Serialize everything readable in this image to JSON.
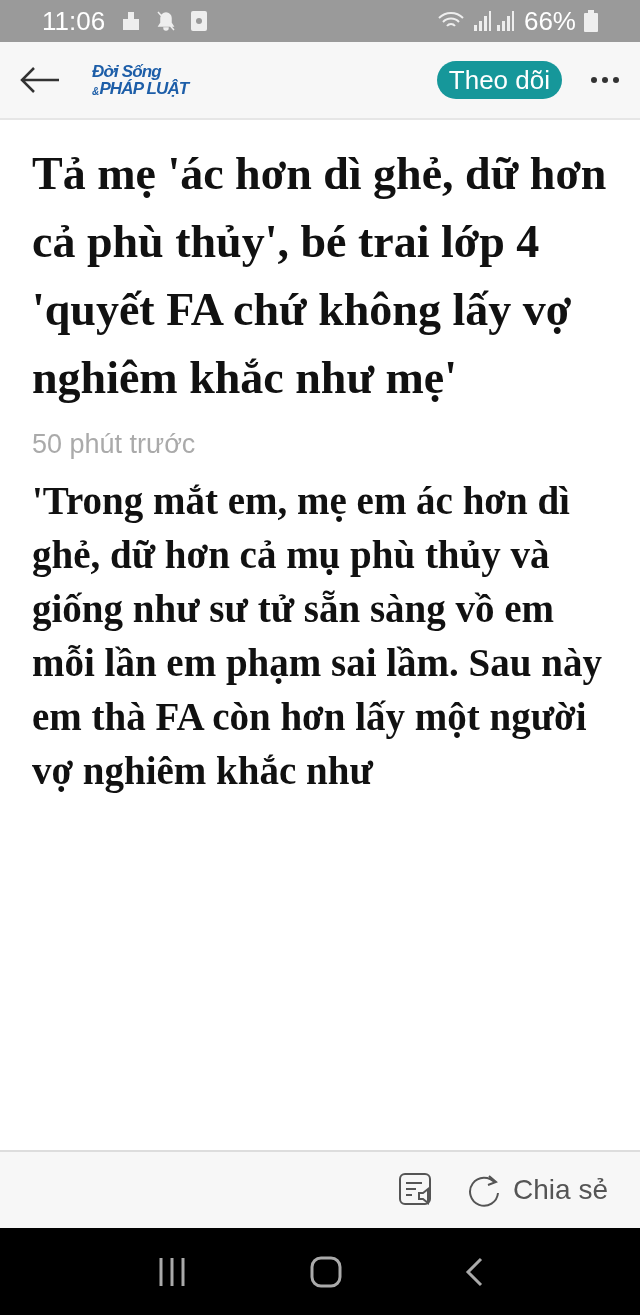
{
  "status_bar": {
    "time": "11:06",
    "battery": "66%"
  },
  "header": {
    "logo_top": "Đời Sống",
    "logo_amp": "&",
    "logo_bottom": "PHÁP LUẬT",
    "follow_button": "Theo dõi"
  },
  "article": {
    "title": "Tả mẹ 'ác hơn dì ghẻ, dữ hơn cả phù thủy', bé trai lớp 4 'quyết FA chứ không lấy vợ nghiêm khắc như mẹ'",
    "time": "50 phút trước",
    "body": "'Trong mắt em, mẹ em ác hơn dì ghẻ, dữ hơn cả mụ phù thủy và giống như sư tử sẵn sàng vồ em mỗi lần em phạm sai lầm. Sau này em thà FA còn hơn lấy một người vợ nghiêm khắc như"
  },
  "toolbar": {
    "share": "Chia sẻ"
  }
}
